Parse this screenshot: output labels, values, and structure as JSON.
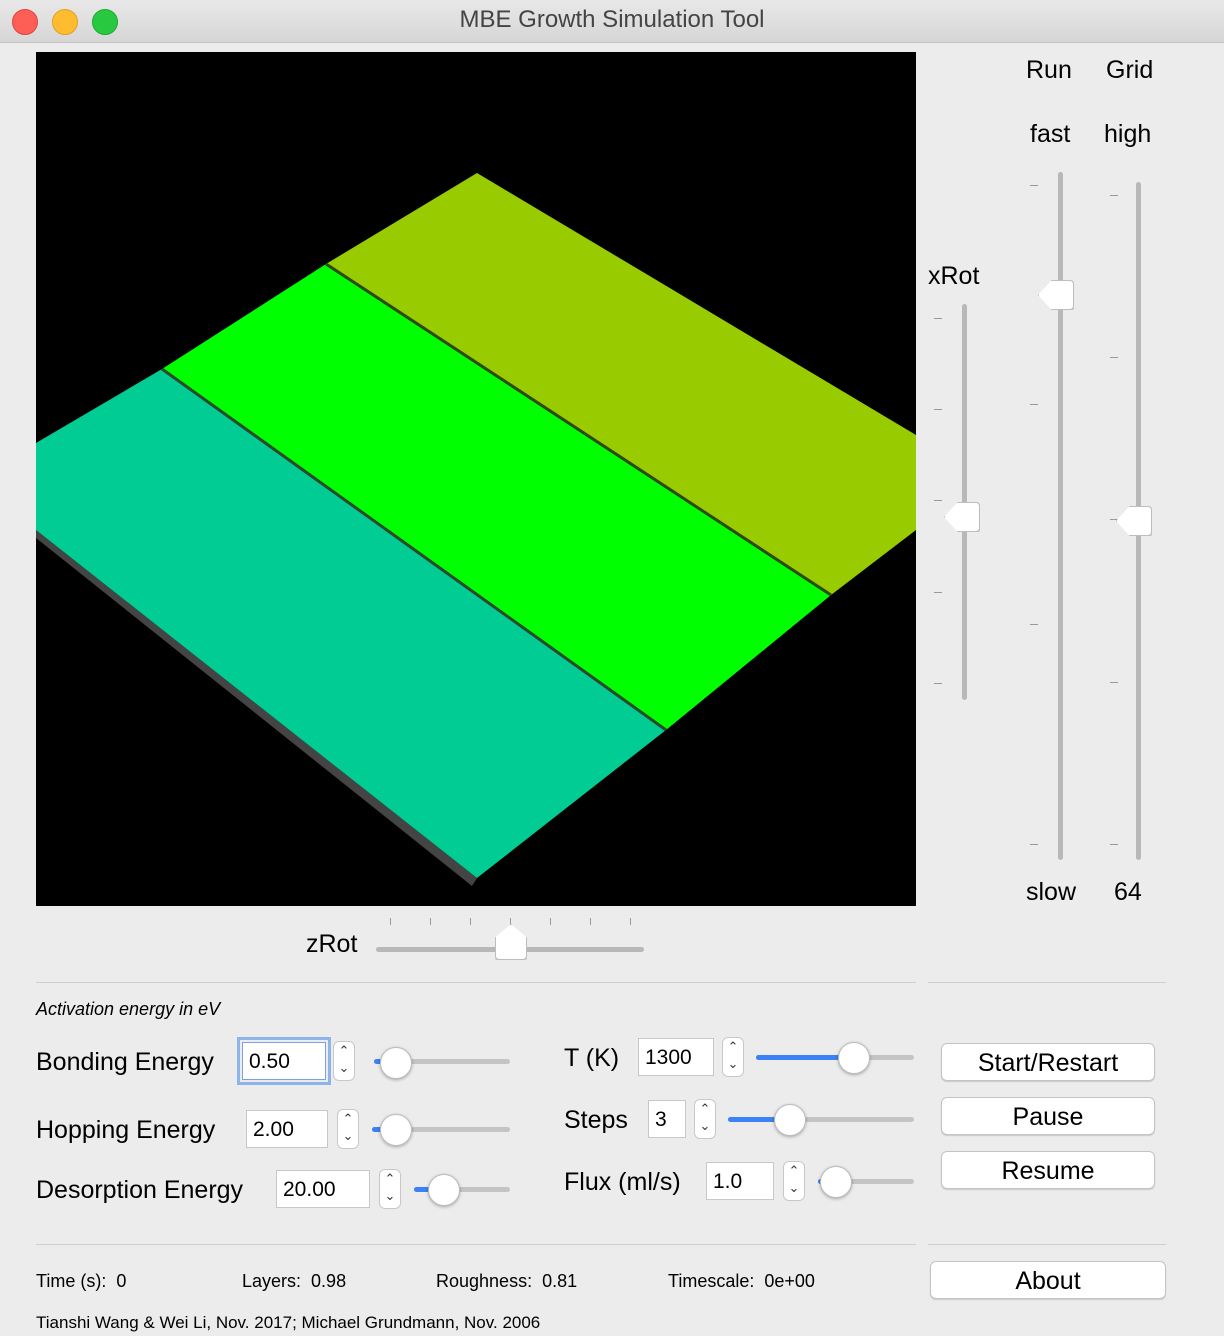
{
  "window": {
    "title": "MBE Growth Simulation Tool"
  },
  "right_controls": {
    "run": {
      "label": "Run",
      "top_label": "fast",
      "bottom_label": "slow",
      "value_fraction": 0.82
    },
    "grid": {
      "label": "Grid",
      "top_label": "high",
      "bottom_label": "64",
      "value_fraction": 0.5
    }
  },
  "xrot": {
    "label": "xRot",
    "value_fraction": 0.5
  },
  "zrot": {
    "label": "zRot",
    "value_fraction": 0.5
  },
  "params": {
    "section_title": "Activation energy in eV",
    "bonding": {
      "label": "Bonding Energy",
      "value": "0.50",
      "slider_fraction": 0.08
    },
    "hopping": {
      "label": "Hopping Energy",
      "value": "2.00",
      "slider_fraction": 0.08
    },
    "desorption": {
      "label": "Desorption Energy",
      "value": "20.00",
      "slider_fraction": 0.3
    },
    "temperature": {
      "label": "T (K)",
      "value": "1300",
      "slider_fraction": 0.62
    },
    "steps": {
      "label": "Steps",
      "value": "3",
      "slider_fraction": 0.3
    },
    "flux": {
      "label": "Flux (ml/s)",
      "value": "1.0",
      "slider_fraction": 0.08
    }
  },
  "buttons": {
    "start": "Start/Restart",
    "pause": "Pause",
    "resume": "Resume",
    "about": "About"
  },
  "status": {
    "time_label": "Time (s):",
    "time_value": "0",
    "layers_label": "Layers:",
    "layers_value": "0.98",
    "roughness_label": "Roughness:",
    "roughness_value": "0.81",
    "timescale_label": "Timescale:",
    "timescale_value": "0e+00"
  },
  "credits": "Tianshi Wang & Wei Li, Nov. 2017;  Michael Grundmann, Nov. 2006",
  "colors": {
    "layer_front": "#00cc93",
    "layer_middle": "#00ff00",
    "layer_back": "#99cc00",
    "accent": "#3b82f6"
  }
}
